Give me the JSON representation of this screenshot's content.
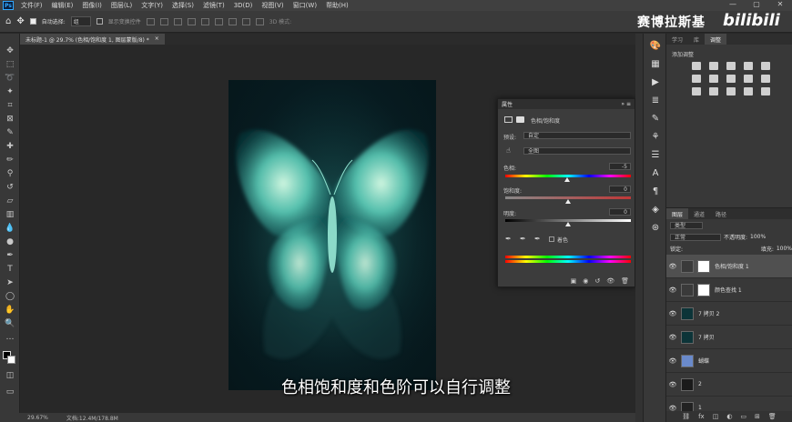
{
  "app": {
    "logo_text": "Ps"
  },
  "menubar": {
    "items": [
      "文件(F)",
      "编辑(E)",
      "图像(I)",
      "图层(L)",
      "文字(Y)",
      "选择(S)",
      "滤镜(T)",
      "3D(D)",
      "视图(V)",
      "窗口(W)",
      "帮助(H)"
    ],
    "window_controls": [
      "—",
      "▢",
      "✕"
    ]
  },
  "options": {
    "auto_select_label": "自动选择:",
    "auto_select_value": "组",
    "show_transform_label": "显示变换控件",
    "mode_3d": "3D 模式:"
  },
  "watermark": {
    "brand": "赛博拉斯基",
    "site": "bilibili"
  },
  "document": {
    "tab_title": "未标题-1 @ 29.7% (色相/饱和度 1, 图层蒙版/8) *",
    "close": "×"
  },
  "status": {
    "zoom": "29.67%",
    "doc_info": "文档:12.4M/178.8M"
  },
  "subtitle": "色相饱和度和色阶可以自行调整",
  "properties": {
    "panel_title": "属性",
    "panel_controls": "»  ≡",
    "adjustment_name": "色相/饱和度",
    "preset_label": "预设:",
    "preset_value": "自定",
    "channel_value": "全图",
    "hue_label": "色相:",
    "hue_value": "-5",
    "hue_level": 0.49,
    "saturation_label": "饱和度:",
    "saturation_value": "0",
    "saturation_level": 0.5,
    "lightness_label": "明度:",
    "lightness_value": "0",
    "lightness_level": 0.5,
    "colorize_label": "着色",
    "colors": {
      "accent": "#31a8ff",
      "panel_bg": "#3c3c3c"
    }
  },
  "adjustments_panel": {
    "tabs": [
      "学习",
      "库",
      "调整"
    ],
    "active_tab": "调整",
    "add_label": "添加调整"
  },
  "layers_panel": {
    "tabs": [
      "图层",
      "通道",
      "路径"
    ],
    "filter_label": "类型",
    "blend_mode": "正常",
    "opacity_label": "不透明度:",
    "opacity_value": "100%",
    "fill_label": "填充:",
    "fill_value": "100%",
    "lock_label": "锁定:",
    "layers": [
      {
        "name": "色相/饱和度 1",
        "type": "adjustment",
        "active": true
      },
      {
        "name": "颜色查找 1",
        "type": "adjustment",
        "active": false
      },
      {
        "name": "7 拷贝 2",
        "type": "image",
        "active": false
      },
      {
        "name": "7 拷贝",
        "type": "image",
        "active": false
      },
      {
        "name": "蝴蝶",
        "type": "image",
        "active": false
      },
      {
        "name": "2",
        "type": "image",
        "active": false
      },
      {
        "name": "1",
        "type": "image",
        "active": false
      }
    ]
  }
}
